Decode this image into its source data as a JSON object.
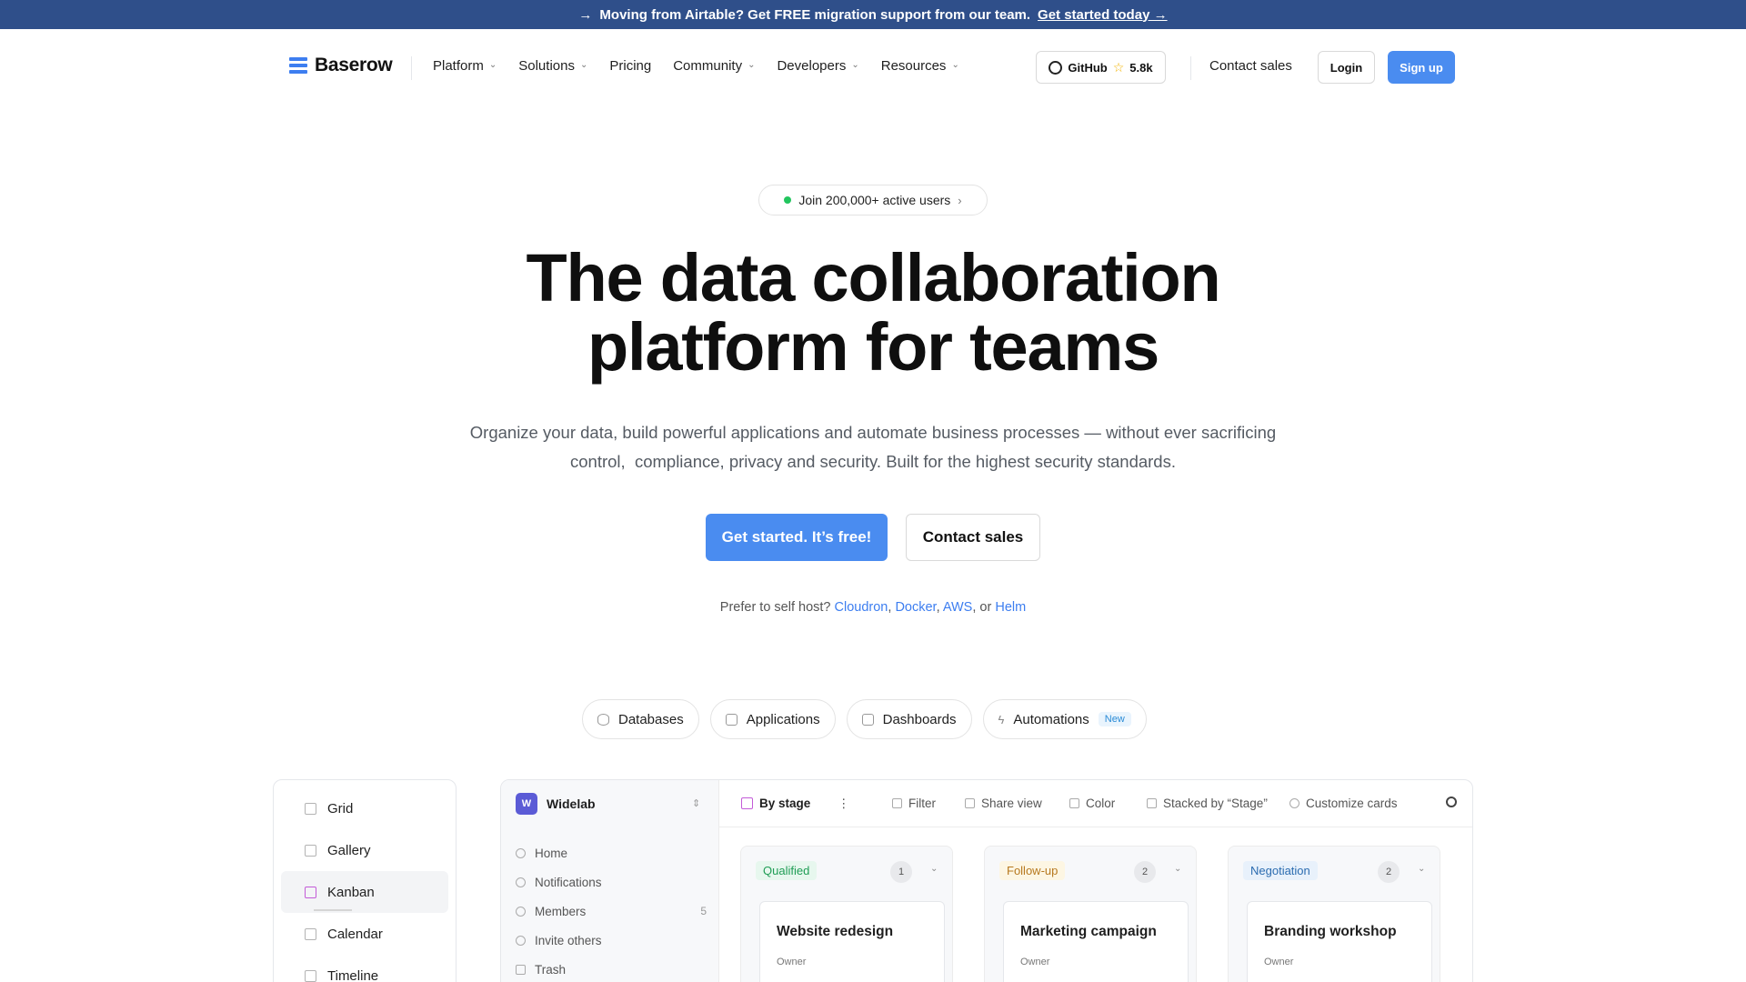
{
  "announcement": {
    "arrow": "→",
    "text": "Moving from Airtable? Get FREE migration support from our team.",
    "link": "Get started today →"
  },
  "nav": {
    "logo": "Baserow",
    "links": [
      {
        "label": "Platform",
        "dropdown": true
      },
      {
        "label": "Solutions",
        "dropdown": true
      },
      {
        "label": "Pricing",
        "dropdown": false
      },
      {
        "label": "Community",
        "dropdown": true
      },
      {
        "label": "Developers",
        "dropdown": true
      },
      {
        "label": "Resources",
        "dropdown": true
      }
    ],
    "github_label": "GitHub",
    "github_stars": "5.8k",
    "contact": "Contact sales",
    "login": "Login",
    "signup": "Sign up"
  },
  "hero": {
    "pill": "Join 200,000+ active users",
    "title_line1": "The data collaboration",
    "title_line2": "platform for teams",
    "subtitle_line1": "Organize your data, build powerful applications and automate business processes — without ever sacrificing",
    "subtitle_line2": "control,  compliance, privacy and security. Built for the highest security standards.",
    "cta_primary": "Get started. It’s free!",
    "cta_secondary": "Contact sales",
    "selfhost_prefix": "Prefer to self host?",
    "selfhost_links": [
      "Cloudron",
      "Docker",
      "AWS",
      "Helm"
    ],
    "selfhost_or": "or"
  },
  "product_tabs": [
    {
      "label": "Databases",
      "icon": "database-icon"
    },
    {
      "label": "Applications",
      "icon": "window-icon"
    },
    {
      "label": "Dashboards",
      "icon": "dashboard-icon"
    },
    {
      "label": "Automations",
      "icon": "bolt-icon",
      "badge": "New"
    }
  ],
  "views": [
    {
      "label": "Grid",
      "icon": "list-icon",
      "active": false
    },
    {
      "label": "Gallery",
      "icon": "gallery-icon",
      "active": false
    },
    {
      "label": "Kanban",
      "icon": "kanban-icon",
      "active": true
    },
    {
      "label": "Calendar",
      "icon": "calendar-icon",
      "active": false
    },
    {
      "label": "Timeline",
      "icon": "timeline-icon",
      "active": false
    }
  ],
  "app": {
    "workspace_initial": "W",
    "workspace": "Widelab",
    "sidebar": [
      {
        "label": "Home",
        "icon": "home-icon"
      },
      {
        "label": "Notifications",
        "icon": "bell-icon"
      },
      {
        "label": "Members",
        "icon": "members-icon",
        "count": "5"
      },
      {
        "label": "Invite others",
        "icon": "invite-icon"
      },
      {
        "label": "Trash",
        "icon": "trash-icon"
      }
    ],
    "toolbar": {
      "view_name": "By stage",
      "more": "⋮",
      "filter": "Filter",
      "share": "Share view",
      "color": "Color",
      "stacked": "Stacked by “Stage”",
      "customize": "Customize cards"
    },
    "columns": [
      {
        "name": "Qualified",
        "count": "1",
        "color": "#1f9d55",
        "bg": "#e7f7ee",
        "card_title": "Website redesign",
        "card_field": "Owner"
      },
      {
        "name": "Follow-up",
        "count": "2",
        "color": "#b7791f",
        "bg": "#fdf6e3",
        "card_title": "Marketing campaign",
        "card_field": "Owner"
      },
      {
        "name": "Negotiation",
        "count": "2",
        "color": "#2b6cb0",
        "bg": "#e8f1fb",
        "card_title": "Branding workshop",
        "card_field": "Owner"
      }
    ]
  },
  "colors": {
    "brand": "#4a8cf0",
    "banner": "#2f4f8a",
    "link": "#3d7ef0"
  }
}
